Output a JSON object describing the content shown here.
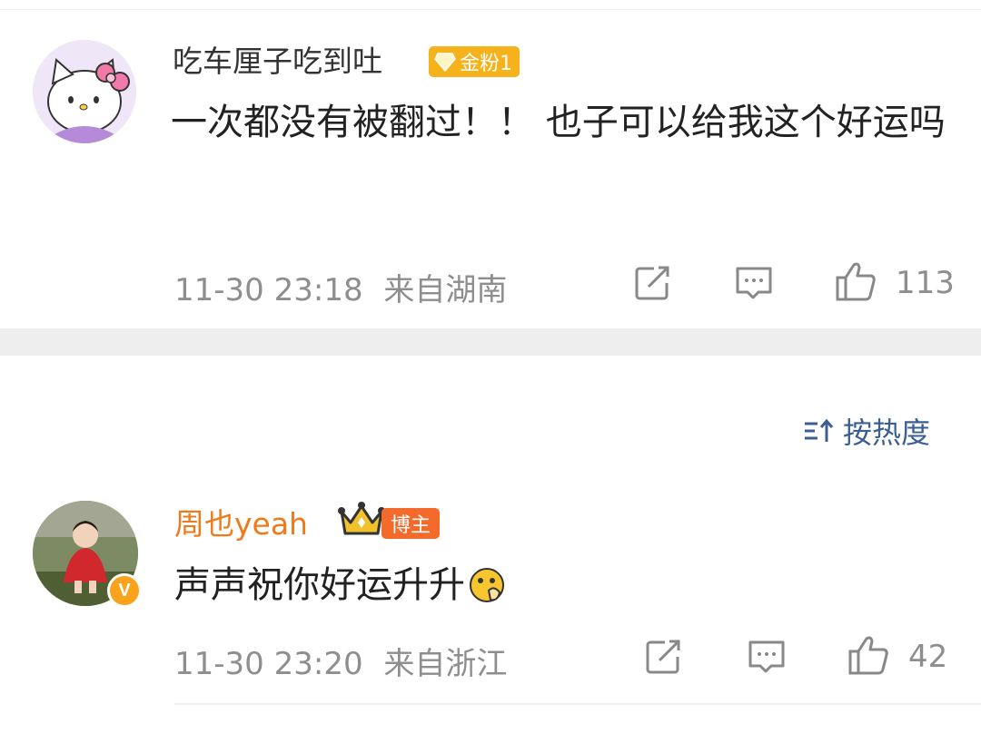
{
  "comments": [
    {
      "username": "吃车厘子吃到吐",
      "badge": "金粉1",
      "badge_color": "#f6b21a",
      "text": "一次都没有被翻过！！ 也子可以给我这个好运吗",
      "time": "11-30 23:18",
      "location": "来自湖南",
      "likes": "113",
      "avatar_icon": "hello-kitty-avatar"
    },
    {
      "username": "周也yeah",
      "username_color": "#f07a1a",
      "badge": "博主",
      "badge_color": "#f46a2a",
      "text": "声声祝你好运升升",
      "emoji": "praying-face-emoji",
      "time": "11-30 23:20",
      "location": "来自浙江",
      "likes": "42",
      "avatar_icon": "child-photo-avatar",
      "verified": "V"
    }
  ],
  "sort": {
    "label": "按热度",
    "icon": "sort-icon"
  },
  "colors": {
    "divider": "#eeeeee",
    "meta_text": "#8e8e8e",
    "link": "#3b5f93"
  }
}
